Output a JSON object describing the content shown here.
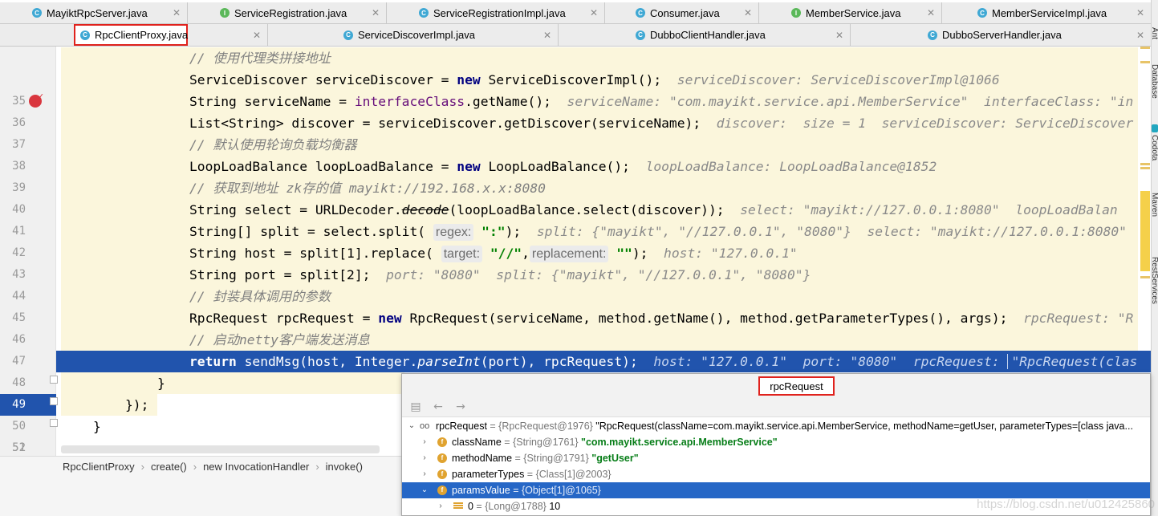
{
  "tabs_row1": [
    {
      "label": "MayiktRpcServer.java",
      "kind": "c"
    },
    {
      "label": "ServiceRegistration.java",
      "kind": "i"
    },
    {
      "label": "ServiceRegistrationImpl.java",
      "kind": "c"
    },
    {
      "label": "Consumer.java",
      "kind": "c"
    },
    {
      "label": "MemberService.java",
      "kind": "i"
    },
    {
      "label": "MemberServiceImpl.java",
      "kind": "c"
    }
  ],
  "tabs_row2": [
    {
      "label": "RpcClientProxy.java",
      "kind": "c",
      "active": true
    },
    {
      "label": "ServiceDiscoverImpl.java",
      "kind": "c"
    },
    {
      "label": "DubboClientHandler.java",
      "kind": "c"
    },
    {
      "label": "DubboServerHandler.java",
      "kind": "c"
    }
  ],
  "tool_strip": {
    "ant": "Ant",
    "database": "Database",
    "codota": "Codota",
    "maven": "Maven",
    "restservices": "RestServices"
  },
  "editor": {
    "line_numbers": [
      "35",
      "36",
      "37",
      "38",
      "39",
      "40",
      "41",
      "42",
      "43",
      "44",
      "45",
      "46",
      "47",
      "48",
      "49",
      "50",
      "51",
      "52",
      "53"
    ],
    "l35": {
      "comment": "// 使用代理类拼接地址"
    },
    "l36": {
      "a": "ServiceDiscover serviceDiscover = ",
      "kw": "new",
      "b": " ServiceDiscoverImpl();",
      "dbg": "serviceDiscover: ServiceDiscoverImpl@1066"
    },
    "l37": {
      "a": "String serviceName = ",
      "fld": "interfaceClass",
      "b": ".getName();",
      "dbg": "serviceName: \"com.mayikt.service.api.MemberService\"  interfaceClass: \"in"
    },
    "l38": {
      "a": "List<String> discover = serviceDiscover.getDiscover(serviceName);",
      "dbg": "discover:  size = 1  serviceDiscover: ServiceDiscover"
    },
    "l39": {
      "comment": "// 默认使用轮询负载均衡器"
    },
    "l40": {
      "a": "LoopLoadBalance loopLoadBalance = ",
      "kw": "new",
      "b": " LoopLoadBalance();",
      "dbg": "loopLoadBalance: LoopLoadBalance@1852"
    },
    "l41": {
      "comment": "// 获取到地址 zk存的值 mayikt://192.168.x.x:8080"
    },
    "l42": {
      "a": "String select = URLDecoder.",
      "strike": "decode",
      "b": "(loopLoadBalance.select(discover));",
      "dbg": "select: \"mayikt://127.0.0.1:8080\"  loopLoadBalan"
    },
    "l43": {
      "a": "String[] split = select.split(",
      "hint": "regex:",
      "str": "\":\"",
      "b": ");",
      "dbg": "split: {\"mayikt\", \"//127.0.0.1\", \"8080\"}  select: \"mayikt://127.0.0.1:8080\""
    },
    "l44": {
      "a": "String host = split[1].replace(",
      "hint1": "target:",
      "str1": "\"//\"",
      "c": ",",
      "hint2": "replacement:",
      "str2": "\"\"",
      "b": ");",
      "dbg": "host: \"127.0.0.1\""
    },
    "l45": {
      "a": "String port = split[2];",
      "dbg": "port: \"8080\"  split: {\"mayikt\", \"//127.0.0.1\", \"8080\"}"
    },
    "l46": {
      "comment": "// 封装具体调用的参数"
    },
    "l47": {
      "a": "RpcRequest rpcRequest = ",
      "kw": "new",
      "b": " RpcRequest(serviceName, method.getName(), method.getParameterTypes(), args);",
      "dbg": "rpcRequest: \"R"
    },
    "l48": {
      "comment": "// 启动netty客户端发送消息"
    },
    "l49": {
      "kw": "return",
      "a": " sendMsg(host, Integer.",
      "itl": "parseInt",
      "b": "(port), rpcRequest);",
      "dbg": "host: \"127.0.0.1\"  port: \"8080\"  rpcRequest: ",
      "dbg2": "\"RpcRequest(clas"
    },
    "l50": {
      "a": "}"
    },
    "l51": {
      "a": "});"
    },
    "l52": {
      "a": "}"
    }
  },
  "breadcrumb": [
    "RpcClientProxy",
    "create()",
    "new InvocationHandler",
    "invoke()"
  ],
  "popup": {
    "title": "rpcRequest",
    "rows": [
      {
        "name": "rpcRequest",
        "type": " = {RpcRequest@1976} ",
        "value": "\"RpcRequest(className=com.mayikt.service.api.MemberService, methodName=getUser, parameterTypes=[class java..."
      },
      {
        "name": "className",
        "type": " = {String@1761} ",
        "value": "\"com.mayikt.service.api.MemberService\""
      },
      {
        "name": "methodName",
        "type": " = {String@1791} ",
        "value": "\"getUser\""
      },
      {
        "name": "parameterTypes",
        "type": " = {Class[1]@2003}",
        "value": ""
      },
      {
        "name": "paramsValue",
        "type": " = {Object[1]@1065}",
        "value": ""
      },
      {
        "name": "0",
        "type": " = {Long@1788} ",
        "value": "10"
      }
    ]
  },
  "watermark": "https://blog.csdn.net/u012425860",
  "colors": {
    "exec_line": "#2154ad",
    "selection": "#2667c6",
    "highlight_bg": "#fbf6dc",
    "active_tab_border": "#e0221d",
    "breakpoint": "#d9363e"
  }
}
